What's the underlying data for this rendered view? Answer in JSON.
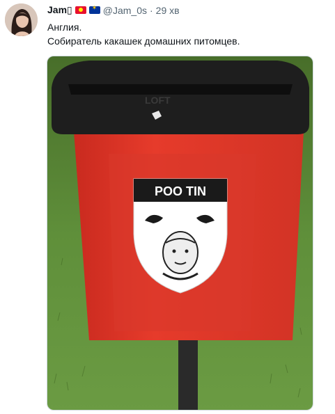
{
  "tweet": {
    "author_name": "Jam",
    "name_glyph": "▯",
    "handle": "@Jam_0s",
    "separator": "·",
    "time": "29 хв",
    "text_line1": "Англия.",
    "text_line2": "Собиратель какашек домашних питомцев."
  },
  "photo": {
    "sign_text": "POO TIN",
    "lid_brand": "LOFT"
  },
  "colors": {
    "bin_red": "#e23a2a",
    "lid_black": "#1e1e1e",
    "grass": "#5f8f3a"
  }
}
